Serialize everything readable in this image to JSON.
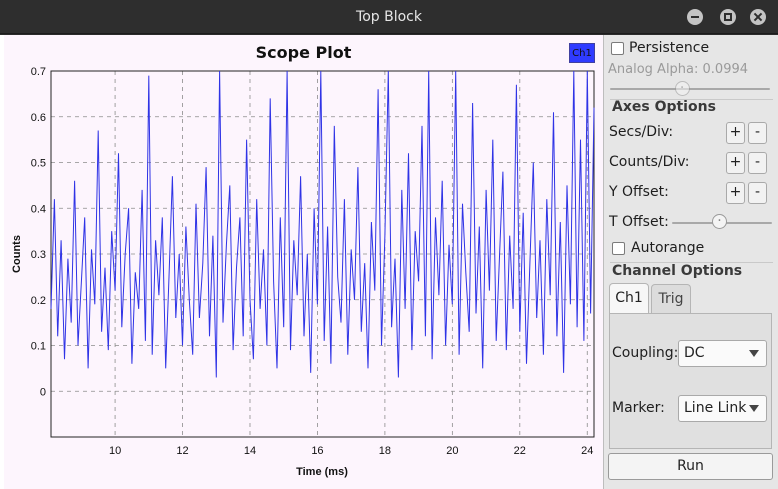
{
  "window": {
    "title": "Top Block"
  },
  "plot": {
    "title": "Scope Plot",
    "legend_label": "Ch1",
    "colors": {
      "trace": "#2f33e6",
      "background": "#fdf5fd",
      "grid": "#8c8c8c"
    }
  },
  "controls": {
    "persistence_label": "Persistence",
    "analog_alpha_label": "Analog Alpha: 0.0994",
    "analog_alpha_value": 0.0994,
    "axes_options_heading": "Axes Options",
    "secs_div_label": "Secs/Div:",
    "counts_div_label": "Counts/Div:",
    "y_offset_label": "Y Offset:",
    "t_offset_label": "T Offset:",
    "plus": "+",
    "minus": "-",
    "autorange_label": "Autorange",
    "channel_options_heading": "Channel Options",
    "tabs": [
      {
        "label": "Ch1",
        "active": true
      },
      {
        "label": "Trig",
        "active": false
      }
    ],
    "coupling_label": "Coupling:",
    "coupling_value": "DC",
    "marker_label": "Marker:",
    "marker_value": "Line Link",
    "run_label": "Run"
  },
  "chart_data": {
    "type": "line",
    "title": "Scope Plot",
    "xlabel": "Time (ms)",
    "ylabel": "Counts",
    "xlim": [
      8.1,
      24.2
    ],
    "ylim": [
      -0.1,
      0.7
    ],
    "xticks": [
      10,
      12,
      14,
      16,
      18,
      20,
      22,
      24
    ],
    "yticks": [
      0,
      0.1,
      0.2,
      0.3,
      0.4,
      0.5,
      0.6,
      0.7
    ],
    "xtick_labels": [
      "10",
      "12",
      "14",
      "16",
      "18",
      "20",
      "22",
      "24"
    ],
    "ytick_labels": [
      "0",
      "0.1",
      "0.2",
      "0.3",
      "0.4",
      "0.5",
      "0.6",
      "0.7"
    ],
    "grid": true,
    "legend": "top-right",
    "series": [
      {
        "name": "Ch1",
        "color": "#2f33e6",
        "x": [
          8.1,
          8.2,
          8.3,
          8.4,
          8.5,
          8.6,
          8.7,
          8.8,
          8.9,
          9.0,
          9.1,
          9.2,
          9.3,
          9.4,
          9.5,
          9.6,
          9.7,
          9.8,
          9.9,
          10.0,
          10.1,
          10.2,
          10.3,
          10.4,
          10.5,
          10.6,
          10.7,
          10.8,
          10.9,
          11.0,
          11.1,
          11.2,
          11.3,
          11.4,
          11.5,
          11.6,
          11.7,
          11.8,
          11.9,
          12.0,
          12.1,
          12.2,
          12.3,
          12.4,
          12.5,
          12.6,
          12.7,
          12.8,
          12.9,
          13.0,
          13.1,
          13.2,
          13.3,
          13.4,
          13.5,
          13.6,
          13.7,
          13.8,
          13.9,
          14.0,
          14.1,
          14.2,
          14.3,
          14.4,
          14.5,
          14.6,
          14.7,
          14.8,
          14.9,
          15.0,
          15.1,
          15.2,
          15.3,
          15.4,
          15.5,
          15.6,
          15.7,
          15.8,
          15.9,
          16.0,
          16.1,
          16.2,
          16.3,
          16.4,
          16.5,
          16.6,
          16.7,
          16.8,
          16.9,
          17.0,
          17.1,
          17.2,
          17.3,
          17.4,
          17.5,
          17.6,
          17.7,
          17.8,
          17.9,
          18.0,
          18.1,
          18.2,
          18.3,
          18.4,
          18.5,
          18.6,
          18.7,
          18.8,
          18.9,
          19.0,
          19.1,
          19.2,
          19.3,
          19.4,
          19.5,
          19.6,
          19.7,
          19.8,
          19.9,
          20.0,
          20.1,
          20.2,
          20.3,
          20.4,
          20.5,
          20.6,
          20.7,
          20.8,
          20.9,
          21.0,
          21.1,
          21.2,
          21.3,
          21.4,
          21.5,
          21.6,
          21.7,
          21.8,
          21.9,
          22.0,
          22.1,
          22.2,
          22.3,
          22.4,
          22.5,
          22.6,
          22.7,
          22.8,
          22.9,
          23.0,
          23.1,
          23.2,
          23.3,
          23.4,
          23.5,
          23.6,
          23.7,
          23.8,
          23.9,
          24.0,
          24.1,
          24.2
        ],
        "y": [
          0.18,
          0.42,
          0.12,
          0.33,
          0.07,
          0.29,
          0.15,
          0.46,
          0.1,
          0.24,
          0.38,
          0.05,
          0.31,
          0.19,
          0.57,
          0.13,
          0.27,
          0.09,
          0.35,
          0.22,
          0.52,
          0.14,
          0.3,
          0.4,
          0.06,
          0.26,
          0.18,
          0.44,
          0.11,
          0.69,
          0.08,
          0.33,
          0.21,
          0.38,
          0.05,
          0.25,
          0.47,
          0.16,
          0.3,
          0.1,
          0.36,
          0.2,
          0.08,
          0.41,
          0.16,
          0.28,
          0.49,
          0.12,
          0.34,
          0.03,
          0.7,
          0.15,
          0.32,
          0.45,
          0.09,
          0.27,
          0.38,
          0.12,
          0.55,
          0.2,
          0.07,
          0.42,
          0.18,
          0.31,
          0.1,
          0.64,
          0.24,
          0.05,
          0.38,
          0.14,
          0.7,
          0.09,
          0.33,
          0.21,
          0.47,
          0.12,
          0.3,
          0.04,
          0.4,
          0.19,
          0.7,
          0.11,
          0.36,
          0.06,
          0.58,
          0.25,
          0.15,
          0.42,
          0.08,
          0.31,
          0.2,
          0.49,
          0.13,
          0.28,
          0.05,
          0.37,
          0.22,
          0.66,
          0.1,
          0.34,
          0.7,
          0.14,
          0.29,
          0.03,
          0.44,
          0.18,
          0.52,
          0.09,
          0.35,
          0.24,
          0.58,
          0.12,
          0.7,
          0.07,
          0.38,
          0.21,
          0.46,
          0.1,
          0.32,
          0.19,
          0.7,
          0.08,
          0.41,
          0.26,
          0.13,
          0.63,
          0.17,
          0.36,
          0.05,
          0.44,
          0.22,
          0.55,
          0.11,
          0.3,
          0.48,
          0.09,
          0.34,
          0.18,
          0.67,
          0.13,
          0.39,
          0.06,
          0.28,
          0.5,
          0.16,
          0.33,
          0.08,
          0.42,
          0.21,
          0.61,
          0.12,
          0.37,
          0.04,
          0.45,
          0.19,
          0.7,
          0.14,
          0.55,
          0.11,
          0.7,
          0.17,
          0.62
        ]
      }
    ]
  }
}
